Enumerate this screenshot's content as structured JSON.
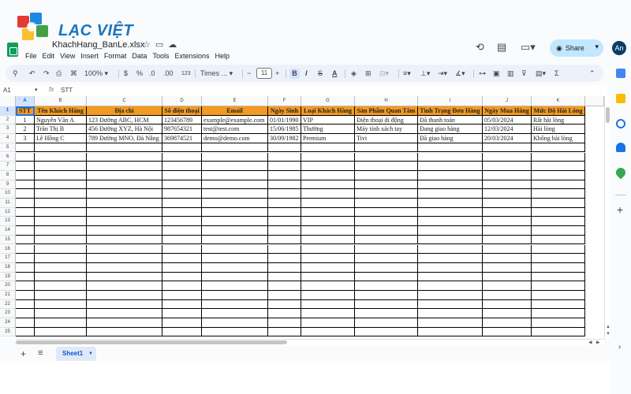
{
  "watermark": {
    "brand": "LẠC VIỆT"
  },
  "document": {
    "title": "KhachHang_BanLe.xlsx"
  },
  "menu": [
    "File",
    "Edit",
    "View",
    "Insert",
    "Format",
    "Data",
    "Tools",
    "Extensions",
    "Help"
  ],
  "header": {
    "share_label": "Share",
    "avatar_initials": "An"
  },
  "toolbar": {
    "zoom": "100%",
    "currency": "$",
    "percent": "%",
    "decrease_decimal": ".0",
    "increase_decimal": ".00",
    "number_format": "123",
    "font": "Times ...",
    "font_size": "11",
    "bold": "B",
    "italic": "I",
    "strike": "S",
    "text_color": "A",
    "sigma": "Σ"
  },
  "formula_bar": {
    "cell_ref": "A1",
    "fx": "fx",
    "value": "STT"
  },
  "columns": [
    "A",
    "B",
    "C",
    "D",
    "E",
    "F",
    "G",
    "H",
    "I",
    "J",
    "K"
  ],
  "table": {
    "headers": [
      "STT",
      "Tên Khách Hàng",
      "Địa chỉ",
      "Số điện thoại",
      "Email",
      "Ngày Sinh",
      "Loại Khách Hàng",
      "Sản Phẩm Quan Tâm",
      "Tình Trạng Đơn Hàng",
      "Ngày Mua Hàng",
      "Mức Độ Hài Lòng"
    ],
    "rows": [
      [
        "1",
        "Nguyễn Văn A",
        "123 Đường ABC, HCM",
        "123456789",
        "example@example.com",
        "01/01/1990",
        "VIP",
        "Điện thoại di động",
        "Đã thanh toán",
        "05/03/2024",
        "Rất hài lòng"
      ],
      [
        "2",
        "Trần Thị B",
        "456 Đường XYZ, Hà Nội",
        "987654321",
        "test@test.com",
        "15/06/1985",
        "Thường",
        "Máy tính xách tay",
        "Đang giao hàng",
        "12/03/2024",
        "Hài lòng"
      ],
      [
        "3",
        "Lê Hồng C",
        "789 Đường MNO, Đà Nẵng",
        "369874521",
        "demo@demo.com",
        "30/09/1982",
        "Premium",
        "Tivi",
        "Đã giao hàng",
        "20/03/2024",
        "Không hài lòng"
      ]
    ]
  },
  "row_numbers": [
    "1",
    "2",
    "3",
    "4",
    "5",
    "6",
    "7",
    "8",
    "9",
    "10",
    "11",
    "12",
    "13",
    "14",
    "15",
    "16",
    "17",
    "18",
    "19",
    "20",
    "21",
    "22",
    "23",
    "24",
    "25"
  ],
  "sheet_tab": {
    "label": "Sheet1"
  },
  "colors": {
    "header_fill": "#f39a21",
    "accent": "#1a73e8",
    "share_bg": "#c2e7ff"
  }
}
